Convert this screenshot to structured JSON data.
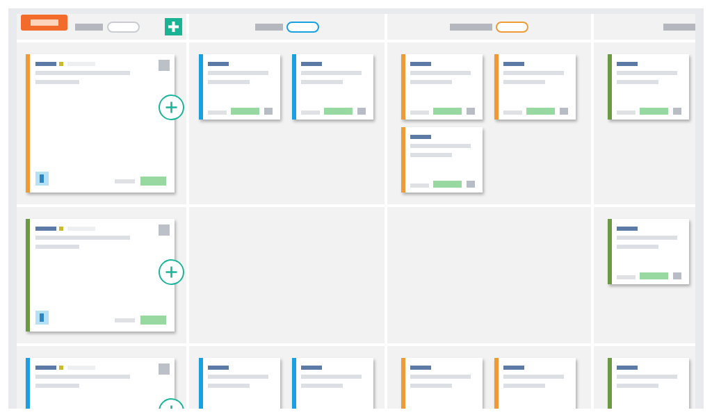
{
  "board": {
    "columns": [
      {
        "kind": "lanes",
        "color": "#c9ccd1"
      },
      {
        "kind": "status",
        "color": "#1a9fe0"
      },
      {
        "kind": "status",
        "color": "#ef9a34"
      },
      {
        "kind": "status"
      }
    ],
    "lanes": [
      {
        "lead_card": {
          "color": "#ef9a34"
        },
        "cells": [
          [
            {
              "color": "#1a9fe0"
            },
            {
              "color": "#1a9fe0"
            }
          ],
          [
            {
              "color": "#ef9a34"
            },
            {
              "color": "#ef9a34"
            },
            {
              "color": "#ef9a34"
            }
          ],
          [
            {
              "color": "#6b9a42"
            }
          ]
        ]
      },
      {
        "lead_card": {
          "color": "#6b9a42"
        },
        "cells": [
          [],
          [],
          [
            {
              "color": "#6b9a42"
            }
          ]
        ]
      },
      {
        "lead_card": {
          "color": "#1a9fe0"
        },
        "cells": [
          [
            {
              "color": "#1a9fe0"
            },
            {
              "color": "#1a9fe0"
            }
          ],
          [
            {
              "color": "#ef9a34"
            },
            {
              "color": "#ef9a34"
            }
          ],
          [
            {
              "color": "#6b9a42"
            }
          ]
        ]
      }
    ]
  }
}
